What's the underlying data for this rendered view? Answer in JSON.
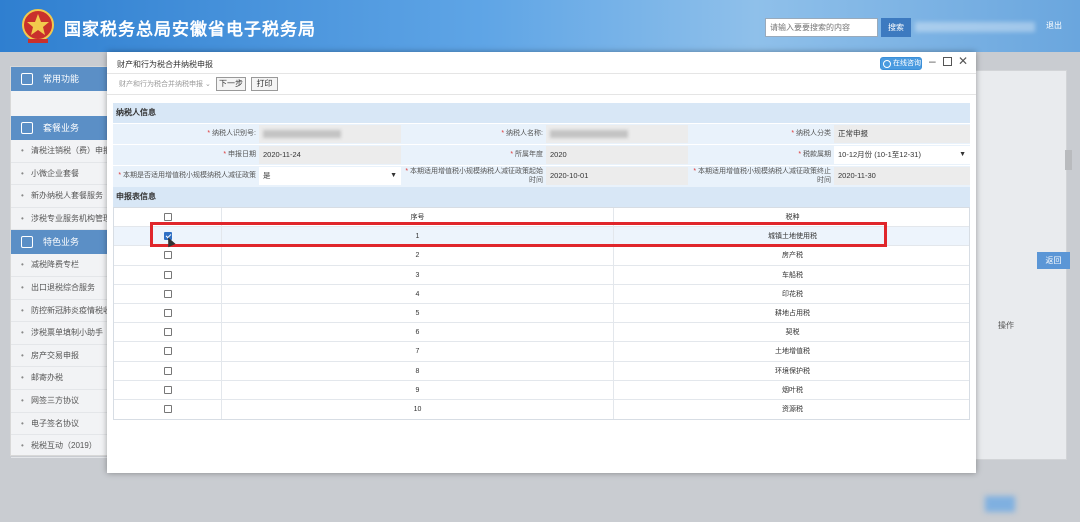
{
  "header": {
    "title": "国家税务总局安徽省电子税务局",
    "search_placeholder": "请输入要要搜索的内容",
    "search_button": "搜索",
    "logout": "退出"
  },
  "sidebar": {
    "common_label": "常用功能",
    "tax_business_label": "套餐业务",
    "tax_items": [
      "清税注销税（费）申报",
      "小微企业套餐",
      "新办纳税人套餐服务",
      "涉税专业服务机构管理"
    ],
    "feature_label": "特色业务",
    "feature_items": [
      "减税降费专栏",
      "出口退税综合服务",
      "防控新冠肺炎疫情税收",
      "涉税票单填制小助手",
      "房产交易申报",
      "邮寄办税",
      "网签三方协议",
      "电子签名协议",
      "税税互动（2019）"
    ]
  },
  "background": {
    "return_button": "返回",
    "operation_header": "操作"
  },
  "modal": {
    "title": "财产和行为税合并纳税申报",
    "consult_button": "在线咨询",
    "tax_select": "财产和行为税合并纳税申报",
    "next_button": "下一步",
    "print_button": "打印",
    "taxpayer_section": "纳税人信息",
    "form_section": "申报表信息"
  },
  "taxpayer_info": {
    "taxpayer_id_label": "纳税人识别号:",
    "taxpayer_name_label": "纳税人名称:",
    "taxpayer_type_label": "纳税人分类",
    "taxpayer_type_value": "正常申报",
    "declare_date_label": "申报日期",
    "declare_date_value": "2020-11-24",
    "belong_year_label": "所属年度",
    "belong_year_value": "2020",
    "tax_period_label": "税款属期",
    "tax_period_value": "10-12月份 (10-1至12-31)",
    "small_scale_label": "本期是否适用增值税小规模纳税人减征政策",
    "small_scale_value": "是",
    "policy_start_label": "本期适用增值税小规模纳税人减征政策起始时间",
    "policy_start_value": "2020-10-01",
    "policy_end_label": "本期适用增值税小规模纳税人减征政策终止时间",
    "policy_end_value": "2020-11-30"
  },
  "form_table": {
    "columns": [
      "序号",
      "税种"
    ],
    "rows": [
      {
        "no": "1",
        "tax": "城镇土地使用税",
        "checked": true
      },
      {
        "no": "2",
        "tax": "房产税",
        "checked": false
      },
      {
        "no": "3",
        "tax": "车船税",
        "checked": false
      },
      {
        "no": "4",
        "tax": "印花税",
        "checked": false
      },
      {
        "no": "5",
        "tax": "耕地占用税",
        "checked": false
      },
      {
        "no": "6",
        "tax": "契税",
        "checked": false
      },
      {
        "no": "7",
        "tax": "土地增值税",
        "checked": false
      },
      {
        "no": "8",
        "tax": "环境保护税",
        "checked": false
      },
      {
        "no": "9",
        "tax": "烟叶税",
        "checked": false
      },
      {
        "no": "10",
        "tax": "资源税",
        "checked": false
      }
    ]
  },
  "colors": {
    "header_blue": "#2f7fd0",
    "section_bg": "#d8e7f6",
    "highlight_red": "#e0262b",
    "checkbox_blue": "#2f6fc4"
  }
}
